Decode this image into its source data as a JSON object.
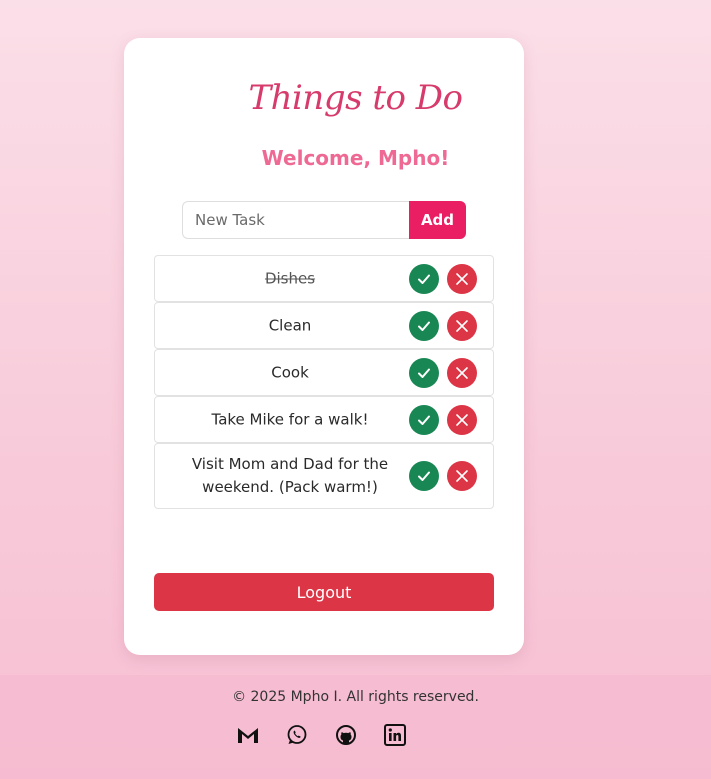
{
  "app": {
    "title": "Things to Do",
    "welcome": "Welcome, Mpho!"
  },
  "add_task": {
    "placeholder": "New Task",
    "value": "",
    "button_label": "Add"
  },
  "tasks": [
    {
      "text": "Dishes",
      "completed": true
    },
    {
      "text": "Clean",
      "completed": false
    },
    {
      "text": "Cook",
      "completed": false
    },
    {
      "text": "Take Mike for a walk!",
      "completed": false
    },
    {
      "text": "Visit Mom and Dad for the weekend. (Pack warm!)",
      "completed": false
    }
  ],
  "actions": {
    "logout_label": "Logout"
  },
  "footer": {
    "copyright": "© 2025 Mpho I. All rights reserved.",
    "social_icons": [
      "gmail-icon",
      "whatsapp-icon",
      "github-icon",
      "linkedin-icon"
    ]
  },
  "colors": {
    "title": "#d63b6b",
    "welcome": "#ee6a94",
    "add_button": "#e91e63",
    "complete_button": "#198754",
    "delete_button": "#dc3545",
    "logout_button": "#dc3545"
  }
}
